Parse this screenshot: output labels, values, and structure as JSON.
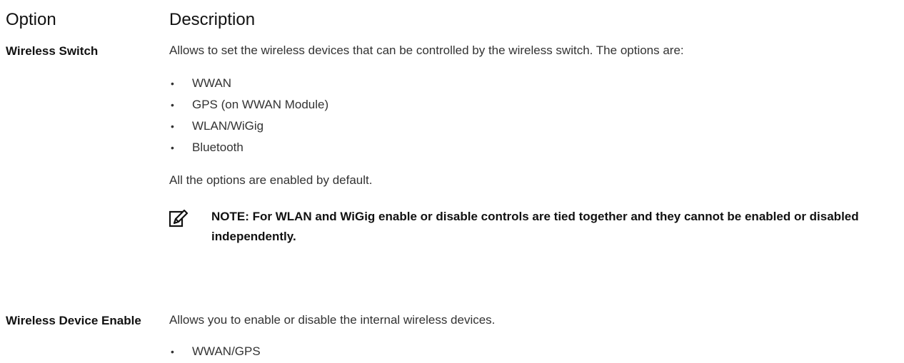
{
  "header": {
    "option": "Option",
    "description": "Description"
  },
  "rows": [
    {
      "option": "Wireless Switch",
      "description": "Allows to set the wireless devices that can be controlled by the wireless switch. The options are:",
      "items": [
        "WWAN",
        "GPS (on WWAN Module)",
        "WLAN/WiGig",
        "Bluetooth"
      ],
      "default_text": "All the options are enabled by default.",
      "note": "NOTE: For WLAN and WiGig enable or disable controls are tied together and they cannot be enabled or disabled independently.",
      "note_icon": "note-pencil-icon"
    },
    {
      "option": "Wireless Device Enable",
      "description": "Allows you to enable or disable the internal wireless devices.",
      "items": [
        "WWAN/GPS"
      ]
    }
  ]
}
